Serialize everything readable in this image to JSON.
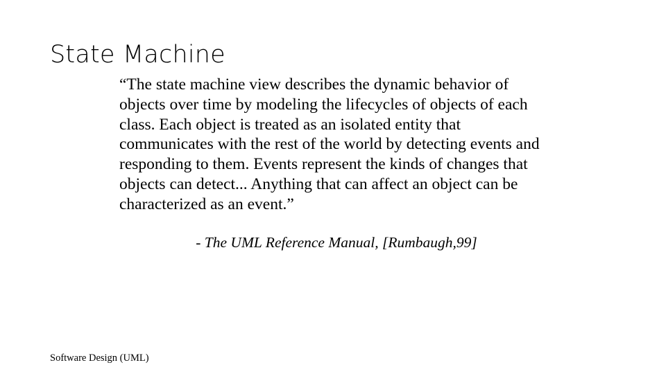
{
  "slide": {
    "title": "State Machine",
    "quote": "“The state machine view describes the dynamic behavior of objects over time by modeling the lifecycles of objects of each class. Each object is treated as an isolated entity that communicates with the rest of the world by detecting events and responding to them. Events represent the kinds of changes that objects can detect... Anything that can affect an object can be characterized as an event.”",
    "attribution": "- The UML Reference Manual, [Rumbaugh,99]",
    "footer": "Software Design (UML)",
    "colors": {
      "background": "#ffffff",
      "text": "#000000"
    }
  }
}
